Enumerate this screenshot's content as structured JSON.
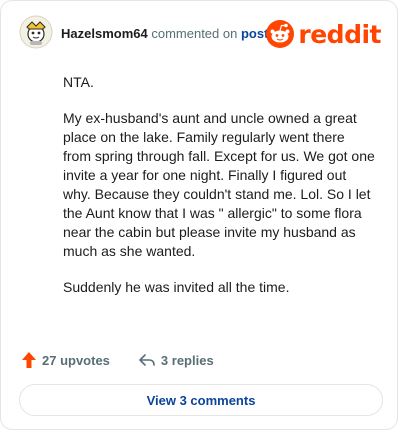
{
  "header": {
    "username": "Hazelsmom64",
    "action_text": "commented on",
    "post_link": "post",
    "brand": "reddit"
  },
  "comment": {
    "paragraphs": [
      "NTA.",
      "My ex-husband's aunt and uncle owned a great place on the lake. Family regularly went there from spring through fall. Except for us. We got one invite a year for one night. Finally I figured out why. Because they couldn't stand me. Lol. So I let the Aunt know that I was \" allergic\" to some flora near the cabin but please invite my husband as much as she wanted.",
      "Suddenly he was invited all the time."
    ]
  },
  "actions": {
    "upvotes": "27 upvotes",
    "replies": "3 replies"
  },
  "view_comments": "View 3 comments",
  "colors": {
    "brand": "#ff4500",
    "link": "#0a449b",
    "meta": "#576f76"
  },
  "icons": [
    "avatar-icon",
    "reddit-snoo-icon",
    "upvote-arrow-icon",
    "reply-arrow-icon"
  ]
}
